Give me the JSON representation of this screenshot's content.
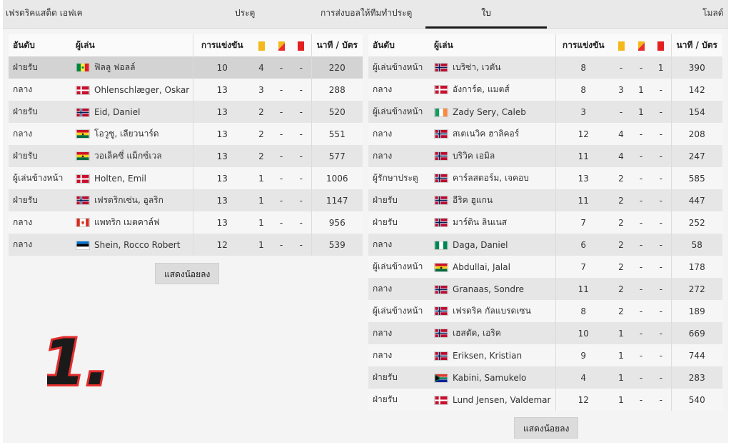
{
  "tabs": [
    "เฟรดริคแสต็ด เอฟเค",
    "ประตู",
    "การส่งบอลให้ทีมทำประตู",
    "ใบ",
    "โมลด์"
  ],
  "active_tab": 3,
  "columns": {
    "rank": "อันดับ",
    "player": "ผู้เล่น",
    "matches": "การแข่งขัน",
    "minutes": "นาที / บัตร"
  },
  "card_colors": {
    "yellow": "#f5b81c",
    "second_yellow": "#ea2d2d",
    "red": "#e41f1f"
  },
  "left_table": [
    {
      "position": "ฝ่ายรับ",
      "flag": "senegal",
      "name": "ฟิลลู ฟอลล์",
      "matches": "10",
      "yellow": "4",
      "second": "-",
      "red": "-",
      "minutes": "220"
    },
    {
      "position": "กลาง",
      "flag": "denmark",
      "name": "Ohlenschlæger, Oskar",
      "matches": "13",
      "yellow": "3",
      "second": "-",
      "red": "-",
      "minutes": "288"
    },
    {
      "position": "ฝ่ายรับ",
      "flag": "norway",
      "name": "Eid, Daniel",
      "matches": "13",
      "yellow": "2",
      "second": "-",
      "red": "-",
      "minutes": "520"
    },
    {
      "position": "กลาง",
      "flag": "ghana",
      "name": "โอวูซู, เลียวนาร์ด",
      "matches": "13",
      "yellow": "2",
      "second": "-",
      "red": "-",
      "minutes": "551"
    },
    {
      "position": "ฝ่ายรับ",
      "flag": "ghana",
      "name": "วอเล็คซี่ แม็กซ์เวล",
      "matches": "13",
      "yellow": "2",
      "second": "-",
      "red": "-",
      "minutes": "577"
    },
    {
      "position": "ผู้เล่นข้างหน้า",
      "flag": "denmark",
      "name": "Holten, Emil",
      "matches": "13",
      "yellow": "1",
      "second": "-",
      "red": "-",
      "minutes": "1006"
    },
    {
      "position": "ฝ่ายรับ",
      "flag": "norway",
      "name": "เฟรดริกเซ่น, อูลริก",
      "matches": "13",
      "yellow": "1",
      "second": "-",
      "red": "-",
      "minutes": "1147"
    },
    {
      "position": "กลาง",
      "flag": "canada",
      "name": "แพทริก เมตคาล์ฟ",
      "matches": "13",
      "yellow": "1",
      "second": "-",
      "red": "-",
      "minutes": "956"
    },
    {
      "position": "กลาง",
      "flag": "estonia",
      "name": "Shein, Rocco Robert",
      "matches": "12",
      "yellow": "1",
      "second": "-",
      "red": "-",
      "minutes": "539"
    }
  ],
  "right_table": [
    {
      "position": "ผู้เล่นข้างหน้า",
      "flag": "norway",
      "name": "เบริซ่า, เวตัน",
      "matches": "8",
      "yellow": "-",
      "second": "-",
      "red": "1",
      "minutes": "390"
    },
    {
      "position": "กลาง",
      "flag": "denmark",
      "name": "อังการ์ด, แมตส์",
      "matches": "8",
      "yellow": "3",
      "second": "1",
      "red": "-",
      "minutes": "142"
    },
    {
      "position": "ผู้เล่นข้างหน้า",
      "flag": "ireland",
      "name": "Zady Sery, Caleb",
      "matches": "3",
      "yellow": "-",
      "second": "1",
      "red": "-",
      "minutes": "154"
    },
    {
      "position": "กลาง",
      "flag": "norway",
      "name": "สเตเนวิค ฮาลิคอร์",
      "matches": "12",
      "yellow": "4",
      "second": "-",
      "red": "-",
      "minutes": "208"
    },
    {
      "position": "กลาง",
      "flag": "norway",
      "name": "บริวิค เอมิล",
      "matches": "11",
      "yellow": "4",
      "second": "-",
      "red": "-",
      "minutes": "247"
    },
    {
      "position": "ผู้รักษาประตู",
      "flag": "norway",
      "name": "คาร์ลสตอร์ม, เจคอบ",
      "matches": "13",
      "yellow": "2",
      "second": "-",
      "red": "-",
      "minutes": "585"
    },
    {
      "position": "ฝ่ายรับ",
      "flag": "norway",
      "name": "อีริค ฮูแกน",
      "matches": "11",
      "yellow": "2",
      "second": "-",
      "red": "-",
      "minutes": "447"
    },
    {
      "position": "ฝ่ายรับ",
      "flag": "norway",
      "name": "มาร์ติน ลินเนส",
      "matches": "7",
      "yellow": "2",
      "second": "-",
      "red": "-",
      "minutes": "252"
    },
    {
      "position": "กลาง",
      "flag": "nigeria",
      "name": "Daga, Daniel",
      "matches": "6",
      "yellow": "2",
      "second": "-",
      "red": "-",
      "minutes": "58"
    },
    {
      "position": "ผู้เล่นข้างหน้า",
      "flag": "ghana",
      "name": "Abdullai, Jalal",
      "matches": "7",
      "yellow": "2",
      "second": "-",
      "red": "-",
      "minutes": "178"
    },
    {
      "position": "กลาง",
      "flag": "norway",
      "name": "Granaas, Sondre",
      "matches": "11",
      "yellow": "2",
      "second": "-",
      "red": "-",
      "minutes": "272"
    },
    {
      "position": "ผู้เล่นข้างหน้า",
      "flag": "norway",
      "name": "เฟรดริค กัลแบรดเซน",
      "matches": "8",
      "yellow": "2",
      "second": "-",
      "red": "-",
      "minutes": "189"
    },
    {
      "position": "กลาง",
      "flag": "norway",
      "name": "เฮสตัด, เอริค",
      "matches": "10",
      "yellow": "1",
      "second": "-",
      "red": "-",
      "minutes": "669"
    },
    {
      "position": "กลาง",
      "flag": "norway",
      "name": "Eriksen, Kristian",
      "matches": "9",
      "yellow": "1",
      "second": "-",
      "red": "-",
      "minutes": "744"
    },
    {
      "position": "ฝ่ายรับ",
      "flag": "south-africa",
      "name": "Kabini, Samukelo",
      "matches": "4",
      "yellow": "1",
      "second": "-",
      "red": "-",
      "minutes": "283"
    },
    {
      "position": "ฝ่ายรับ",
      "flag": "denmark",
      "name": "Lund Jensen, Valdemar",
      "matches": "12",
      "yellow": "1",
      "second": "-",
      "red": "-",
      "minutes": "540"
    }
  ],
  "show_less_label": "แสดงน้อยลง",
  "logo_text": "1."
}
